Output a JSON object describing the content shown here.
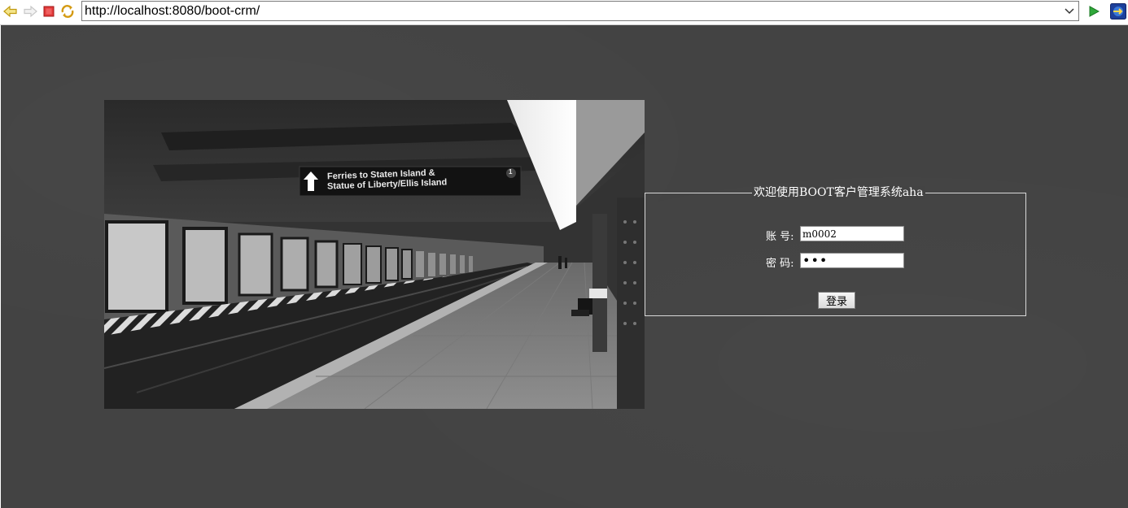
{
  "browser": {
    "url": "http://localhost:8080/boot-crm/",
    "icons": {
      "back": "back-arrow-icon",
      "forward": "forward-arrow-icon",
      "stop": "stop-icon",
      "refresh": "refresh-icon",
      "dropdown": "chevron-down-icon",
      "go": "go-play-icon",
      "external": "external-browser-icon"
    }
  },
  "photo": {
    "sign_line1": "Ferries to Staten Island &",
    "sign_line2": "Statue of Liberty/Ellis Island",
    "sign_number": "1"
  },
  "login": {
    "legend": "欢迎使用BOOT客户管理系统aha",
    "account_label": "账 号:",
    "account_value": "m0002",
    "password_label": "密 码:",
    "password_value": "abc",
    "submit_label": "登录"
  },
  "colors": {
    "page_background": "#434343",
    "text": "#ffffff",
    "fieldset_border": "#d8d8d8"
  }
}
